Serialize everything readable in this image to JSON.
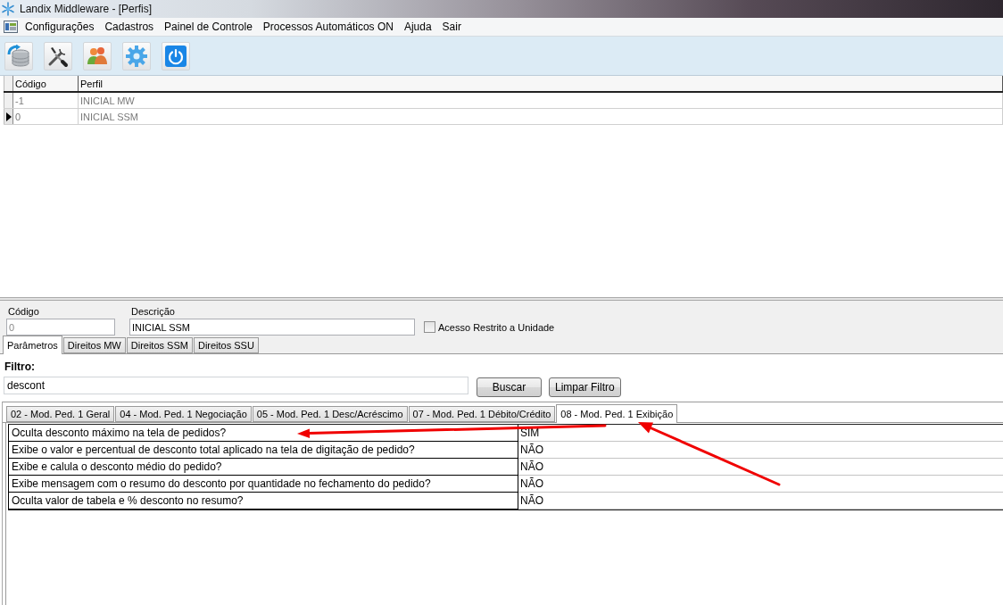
{
  "window": {
    "title": "Landix Middleware - [Perfis]"
  },
  "menu": [
    {
      "label": "Configurações"
    },
    {
      "label": "Cadastros"
    },
    {
      "label": "Painel de Controle"
    },
    {
      "label": "Processos Automáticos ON"
    },
    {
      "label": "Ajuda"
    },
    {
      "label": "Sair"
    }
  ],
  "profiles_grid": {
    "columns": [
      "Código",
      "Perfil"
    ],
    "rows": [
      {
        "code": "-1",
        "profile": "INICIAL MW",
        "selected": false
      },
      {
        "code": "0",
        "profile": "INICIAL SSM",
        "selected": true
      }
    ]
  },
  "form": {
    "code": {
      "label": "Código",
      "value": "0",
      "disabled": true
    },
    "description": {
      "label": "Descrição",
      "value": "INICIAL SSM"
    },
    "restricted_access": {
      "label": "Acesso Restrito a Unidade",
      "checked": false
    }
  },
  "tabs": [
    {
      "label": "Parâmetros",
      "selected": true
    },
    {
      "label": "Direitos MW",
      "selected": false
    },
    {
      "label": "Direitos SSM",
      "selected": false
    },
    {
      "label": "Direitos SSU",
      "selected": false
    }
  ],
  "filter": {
    "label": "Filtro:",
    "value": "descont"
  },
  "buttons": [
    "Buscar",
    "Limpar Filtro"
  ],
  "parameter_tabs": [
    {
      "label": "02 - Mod. Ped. 1 Geral",
      "selected": false
    },
    {
      "label": "04 - Mod. Ped. 1 Negociação",
      "selected": false
    },
    {
      "label": "05 - Mod. Ped. 1 Desc/Acréscimo",
      "selected": false
    },
    {
      "label": "07 - Mod. Ped. 1 Débito/Crédito",
      "selected": false
    },
    {
      "label": "08 - Mod. Ped. 1 Exibição",
      "selected": true
    }
  ],
  "parameters": [
    {
      "question": "Oculta desconto máximo na tela de pedidos?",
      "answer": "SIM"
    },
    {
      "question": "Exibe o valor e percentual de desconto total aplicado na tela de digitação de pedido?",
      "answer": "NÃO"
    },
    {
      "question": "Exibe e calula o desconto médio do pedido?",
      "answer": "NÃO"
    },
    {
      "question": "Exibe mensagem com o resumo do desconto por quantidade no fechamento do pedido?",
      "answer": "NÃO"
    },
    {
      "question": "Oculta valor de tabela e % desconto no resumo?",
      "answer": "NÃO"
    }
  ]
}
